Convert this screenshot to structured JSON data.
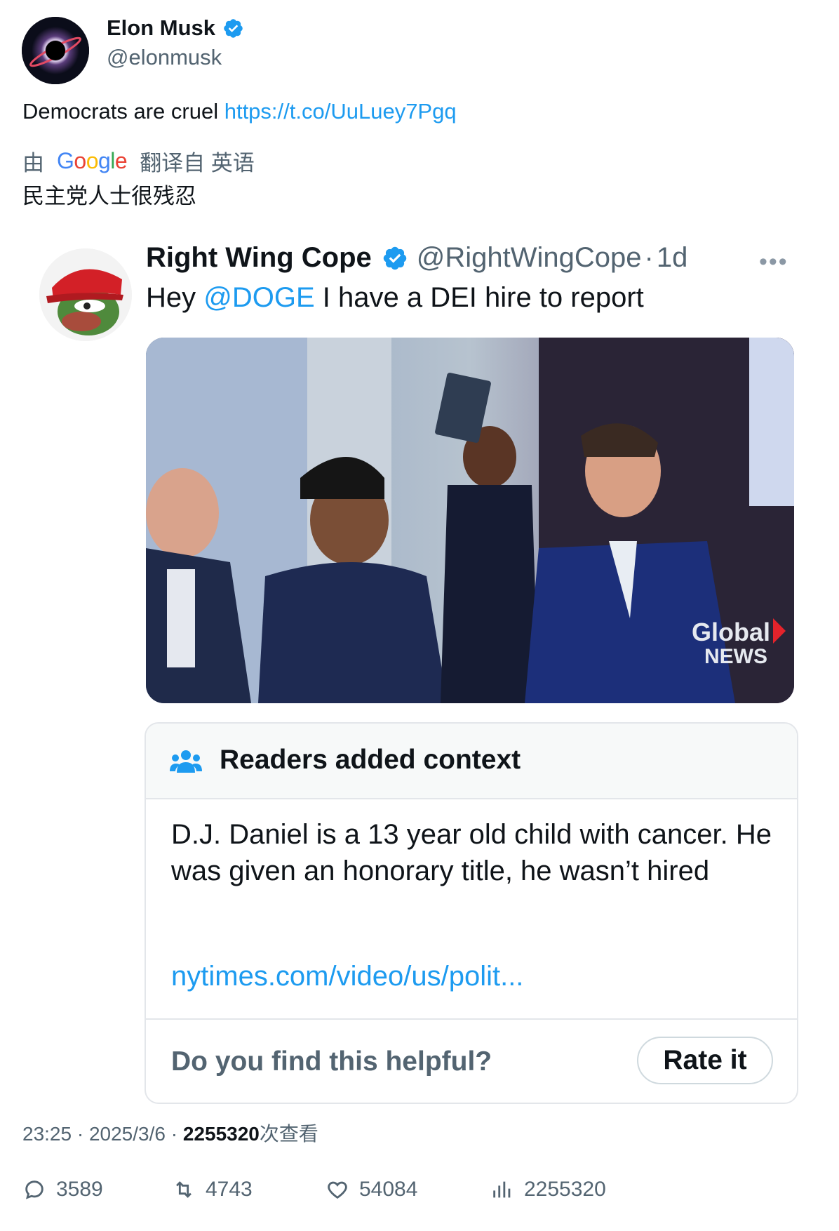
{
  "author": {
    "name": "Elon Musk",
    "handle": "@elonmusk",
    "avatar_icon": "black-hole-avatar",
    "verified_icon": "verified-badge-icon"
  },
  "tweet": {
    "text": "Democrats are cruel",
    "link": "https://t.co/UuLuey7Pgq"
  },
  "translation": {
    "prefix": "由",
    "provider": "Google",
    "suffix": "翻译自 英语",
    "text": "民主党人士很残忍"
  },
  "quoted": {
    "name": "Right Wing Cope",
    "handle": "@RightWingCope",
    "separator": "·",
    "time": "1d",
    "more_icon": "more-horizontal-icon",
    "text_before": "Hey ",
    "mention": "@DOGE",
    "text_after": " I have a DEI hire to report",
    "media_watermark_line1": "Global",
    "media_watermark_line2": "NEWS"
  },
  "community_note": {
    "title": "Readers added context",
    "icon": "people-group-icon",
    "body": "D.J. Daniel is a 13 year old child with cancer. He was given an honorary title, he wasn’t hired",
    "url": "nytimes.com/video/us/polit...",
    "question": "Do you find this helpful?",
    "rate_button": "Rate it"
  },
  "meta": {
    "time": "23:25",
    "date": "2025/3/6",
    "views": "2255320",
    "views_suffix": "次查看"
  },
  "actions": {
    "replies": "3589",
    "retweets": "4743",
    "likes": "54084",
    "views": "2255320"
  },
  "colors": {
    "accent": "#1d9bf0",
    "secondary_text": "#536471",
    "primary_text": "#0f1419"
  }
}
